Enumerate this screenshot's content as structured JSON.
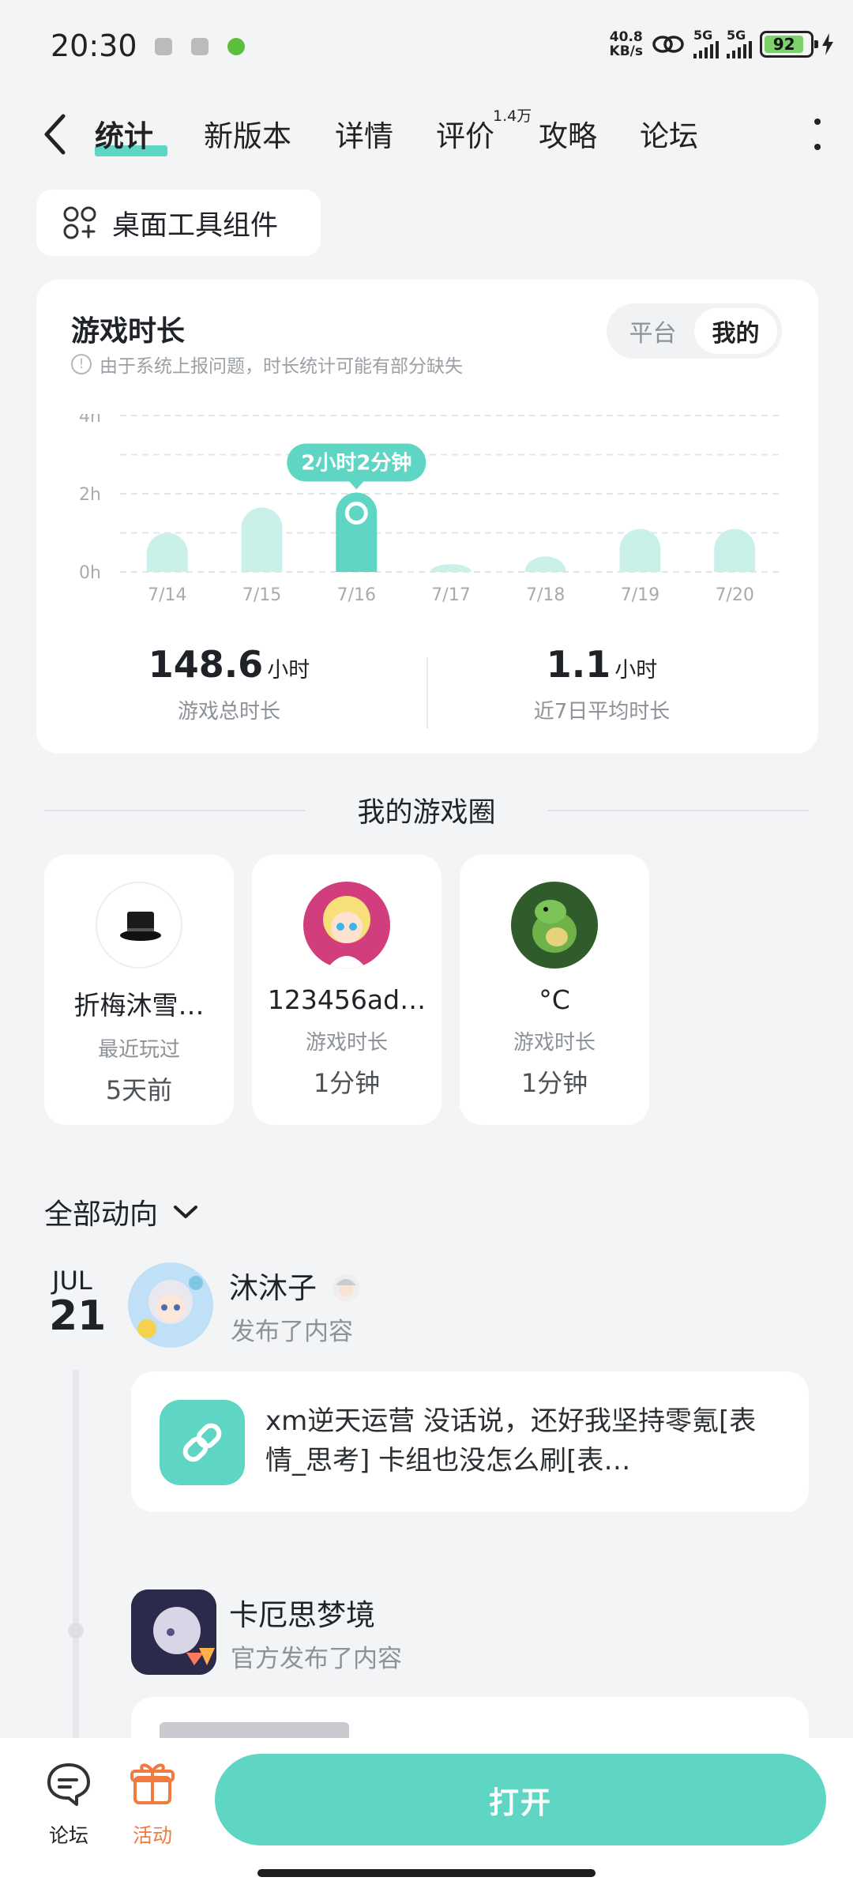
{
  "status_bar": {
    "time": "20:30",
    "net_speed_value": "40.8",
    "net_speed_unit": "KB/s",
    "signal_1": "5G",
    "signal_2": "5G",
    "battery": "92"
  },
  "nav": {
    "tabs": [
      {
        "label": "统计",
        "active": true
      },
      {
        "label": "新版本"
      },
      {
        "label": "详情"
      },
      {
        "label": "评价",
        "badge": "1.4万"
      },
      {
        "label": "攻略"
      },
      {
        "label": "论坛"
      }
    ]
  },
  "widget_button": {
    "label": "桌面工具组件",
    "icon": "widgets-icon"
  },
  "stats": {
    "title": "游戏时长",
    "note": "由于系统上报问题，时长统计可能有部分缺失",
    "toggle": {
      "options": [
        "平台",
        "我的"
      ],
      "selected": "我的"
    },
    "total": {
      "value": "148.6",
      "unit": "小时",
      "label": "游戏总时长"
    },
    "average": {
      "value": "1.1",
      "unit": "小时",
      "label": "近7日平均时长"
    }
  },
  "chart_data": {
    "type": "bar",
    "categories": [
      "7/14",
      "7/15",
      "7/16",
      "7/17",
      "7/18",
      "7/19",
      "7/20"
    ],
    "values": [
      1.0,
      1.65,
      2.03,
      0.2,
      0.4,
      1.1,
      1.1
    ],
    "y_ticks": [
      "0h",
      "2h",
      "4h"
    ],
    "ylim": [
      0,
      4
    ],
    "highlight_index": 2,
    "tooltip": "2小时2分钟",
    "grid": true,
    "colors": {
      "bar": "#c9f1ea",
      "highlight": "#5fd6c3"
    }
  },
  "circle": {
    "title": "我的游戏圈",
    "friends": [
      {
        "name": "折梅沐雪…",
        "meta": "最近玩过",
        "value": "5天前"
      },
      {
        "name": "123456ad…",
        "meta": "游戏时长",
        "value": "1分钟"
      },
      {
        "name": "°C",
        "meta": "游戏时长",
        "value": "1分钟"
      }
    ]
  },
  "activity": {
    "filter": "全部动向",
    "date": {
      "month": "JUL",
      "day": "21"
    },
    "posts": [
      {
        "user": "沐沐子",
        "action": "发布了内容",
        "text": "xm逆天运营 没话说，还好我坚持零氪[表情_思考] 卡组也没怎么刷[表…"
      },
      {
        "user": "卡厄思梦境",
        "action": "官方发布了内容"
      }
    ]
  },
  "bottom_bar": {
    "forum": "论坛",
    "activity": "活动",
    "open": "打开"
  }
}
